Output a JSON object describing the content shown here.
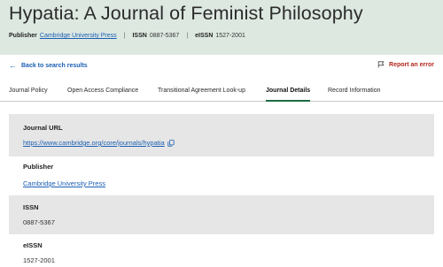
{
  "journal": {
    "title": "Hypatia: A Journal of Feminist Philosophy",
    "publisher_label": "Publisher",
    "publisher_name": "Cambridge University Press",
    "issn_label": "ISSN",
    "issn_value": "0887-5367",
    "eissn_label": "eISSN",
    "eissn_value": "1527-2001",
    "separator": "|"
  },
  "nav": {
    "back_label": "Back to search results",
    "report_label": "Report an error"
  },
  "tabs": [
    {
      "label": "Journal Policy",
      "active": false
    },
    {
      "label": "Open Access Compliance",
      "active": false
    },
    {
      "label": "Transitional Agreement Look-up",
      "active": false
    },
    {
      "label": "Journal Details",
      "active": true
    },
    {
      "label": "Record Information",
      "active": false
    }
  ],
  "details": {
    "url_label": "Journal URL",
    "url_value": "https://www.cambridge.org/core/journals/hypatia",
    "publisher_label": "Publisher",
    "publisher_value": "Cambridge University Press",
    "issn_label": "ISSN",
    "issn_value": "0887-5367",
    "eissn_label": "eISSN",
    "eissn_value": "1527-2001"
  },
  "colors": {
    "header_bg": "#dde8e1",
    "link": "#1b5fb3",
    "error": "#b3261e",
    "active_tab_underline": "#1f6b44",
    "gray_row": "#e6e6e6"
  },
  "icons": {
    "back": "arrow-left-icon",
    "report": "flag-icon",
    "copy": "copy-icon"
  }
}
